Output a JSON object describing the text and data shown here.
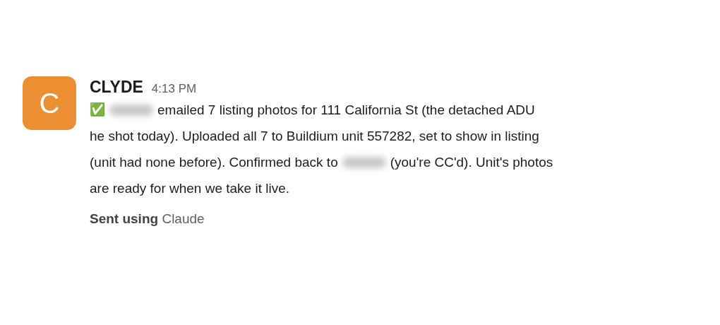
{
  "message": {
    "avatar": {
      "letter": "C",
      "color": "#ec8f33"
    },
    "sender": "CLYDE",
    "time": "4:13 PM",
    "body_lines": [
      [
        {
          "kind": "emoji",
          "text": "✅"
        },
        {
          "kind": "redacted"
        },
        {
          "kind": "text",
          "text": "emailed 7 listing photos for 111 California St (the detached ADU"
        }
      ],
      [
        {
          "kind": "text",
          "text": "he shot today). Uploaded all 7 to Buildium unit 557282, set to show in listing"
        }
      ],
      [
        {
          "kind": "text",
          "text": "(unit had none before). Confirmed back to"
        },
        {
          "kind": "redacted"
        },
        {
          "kind": "text",
          "text": "(you're CC'd). Unit's photos"
        }
      ],
      [
        {
          "kind": "text",
          "text": "are ready for when we take it live."
        }
      ]
    ],
    "footer": "**Sent using** Claude"
  }
}
